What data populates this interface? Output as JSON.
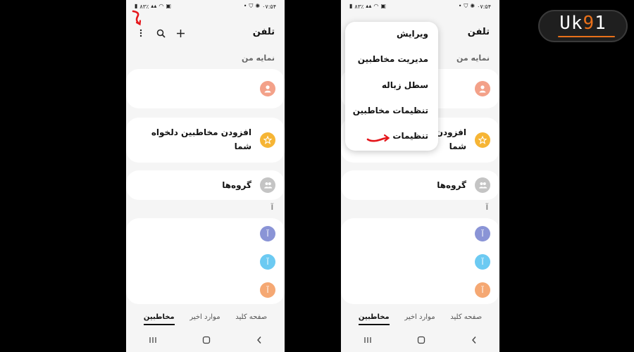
{
  "status_bar": {
    "time": "۰۷:۵۴",
    "battery": "۸۳٪"
  },
  "app": {
    "title": "تلفن"
  },
  "toolbar": {
    "more_icon": "more-vert-icon",
    "search_icon": "search-icon",
    "add_icon": "plus-icon"
  },
  "profile": {
    "section_label": "نمایه من"
  },
  "favorites": {
    "label": "افزودن مخاطبین دلخواه شما",
    "line1": "افزودن مخاطبین دلخواه",
    "line2": "شما"
  },
  "groups": {
    "label": "گروه‌ها"
  },
  "index_letter": "آ",
  "contact_initial": "آ",
  "colors": {
    "profile_avatar": "#f3a189",
    "favorites_avatar": "#f6b535",
    "groups_avatar": "#c4c4c4",
    "contact_1": "#8a94d6",
    "contact_2": "#6ccaf2",
    "contact_3": "#f5a873",
    "annotation": "#e4161b",
    "logo_accent": "#e8701a"
  },
  "tabs": [
    "صفحه کلید",
    "موارد اخیر",
    "مخاطبین"
  ],
  "active_tab": "مخاطبین",
  "menu": {
    "items": [
      "ویرایش",
      "مدیریت مخاطبین",
      "سطل زباله",
      "تنظیمات مخاطبین",
      "تنظیمات"
    ]
  },
  "logo": {
    "text_part1": "U",
    "text_part2": "k",
    "text_part3": "9",
    "text_part4": "1"
  }
}
